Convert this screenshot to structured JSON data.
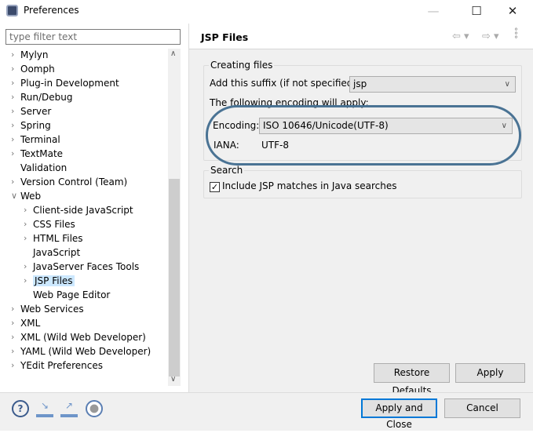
{
  "window": {
    "title": "Preferences",
    "icon": "eclipse-icon",
    "controls": [
      "minimize-icon",
      "maximize-icon",
      "close-icon"
    ]
  },
  "filter": {
    "placeholder": "type filter text",
    "value": ""
  },
  "tree": [
    {
      "label": "Mylyn",
      "level": 0,
      "state": "collapsed"
    },
    {
      "label": "Oomph",
      "level": 0,
      "state": "collapsed"
    },
    {
      "label": "Plug-in Development",
      "level": 0,
      "state": "collapsed"
    },
    {
      "label": "Run/Debug",
      "level": 0,
      "state": "collapsed"
    },
    {
      "label": "Server",
      "level": 0,
      "state": "collapsed"
    },
    {
      "label": "Spring",
      "level": 0,
      "state": "collapsed"
    },
    {
      "label": "Terminal",
      "level": 0,
      "state": "collapsed"
    },
    {
      "label": "TextMate",
      "level": 0,
      "state": "collapsed"
    },
    {
      "label": "Validation",
      "level": 0,
      "state": "leaf"
    },
    {
      "label": "Version Control (Team)",
      "level": 0,
      "state": "collapsed"
    },
    {
      "label": "Web",
      "level": 0,
      "state": "expanded"
    },
    {
      "label": "Client-side JavaScript",
      "level": 1,
      "state": "collapsed"
    },
    {
      "label": "CSS Files",
      "level": 1,
      "state": "collapsed"
    },
    {
      "label": "HTML Files",
      "level": 1,
      "state": "collapsed"
    },
    {
      "label": "JavaScript",
      "level": 1,
      "state": "leaf"
    },
    {
      "label": "JavaServer Faces Tools",
      "level": 1,
      "state": "collapsed"
    },
    {
      "label": "JSP Files",
      "level": 1,
      "state": "collapsed",
      "selected": true
    },
    {
      "label": "Web Page Editor",
      "level": 1,
      "state": "leaf"
    },
    {
      "label": "Web Services",
      "level": 0,
      "state": "collapsed"
    },
    {
      "label": "XML",
      "level": 0,
      "state": "collapsed"
    },
    {
      "label": "XML (Wild Web Developer)",
      "level": 0,
      "state": "collapsed"
    },
    {
      "label": "YAML (Wild Web Developer)",
      "level": 0,
      "state": "collapsed"
    },
    {
      "label": "YEdit Preferences",
      "level": 0,
      "state": "collapsed"
    }
  ],
  "page": {
    "title": "JSP Files",
    "creating": {
      "legend": "Creating files",
      "suffix_label": "Add this suffix (if not specified):",
      "suffix_value": "jsp",
      "apply_text": "The following encoding will apply:",
      "encoding_label": "Encoding:",
      "encoding_value": "ISO 10646/Unicode(UTF-8)",
      "iana_label": "IANA:",
      "iana_value": "UTF-8"
    },
    "search": {
      "legend": "Search",
      "include_label": "Include JSP matches in Java searches",
      "include_checked": true
    },
    "restore_label": "Restore Defaults",
    "apply_label": "Apply"
  },
  "annotation_color": "#4a7394",
  "footer": {
    "icons": [
      "help-icon",
      "import-icon",
      "export-icon",
      "record-icon"
    ],
    "apply_close_label": "Apply and Close",
    "cancel_label": "Cancel"
  }
}
